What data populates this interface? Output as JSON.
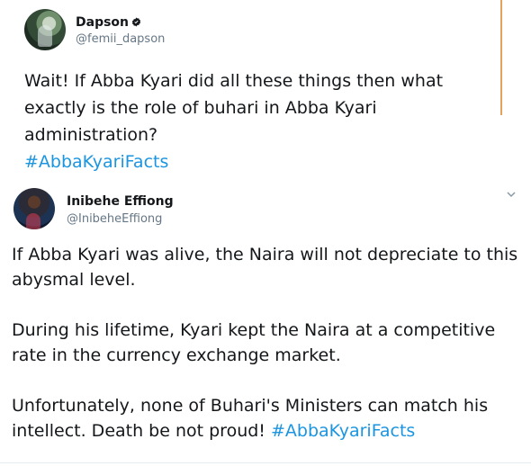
{
  "tweets": [
    {
      "display_name": "Dapson",
      "handle": "@femii_dapson",
      "text_lines": [
        "Wait! If Abba Kyari did all these things then what",
        "exactly is the role of buhari in Abba Kyari",
        "administration?"
      ],
      "hashtag": "#AbbaKyariFacts"
    },
    {
      "display_name": "Inibehe Effiong",
      "handle": "@InibeheEffiong",
      "paragraphs": [
        "If Abba Kyari was alive, the Naira will not depreciate to this abysmal level.",
        "During his lifetime, Kyari kept the Naira at a competitive rate in the currency exchange market.",
        "Unfortunately, none of Buhari's Ministers can match his intellect. Death be not proud!"
      ],
      "hashtag": "#AbbaKyariFacts"
    }
  ],
  "icons": {
    "verified": "verified-icon",
    "menu": "chevron-down-icon"
  },
  "colors": {
    "hashtag": "#1b95e0",
    "handle": "#657786",
    "accent_bar": "#e1a45a"
  }
}
